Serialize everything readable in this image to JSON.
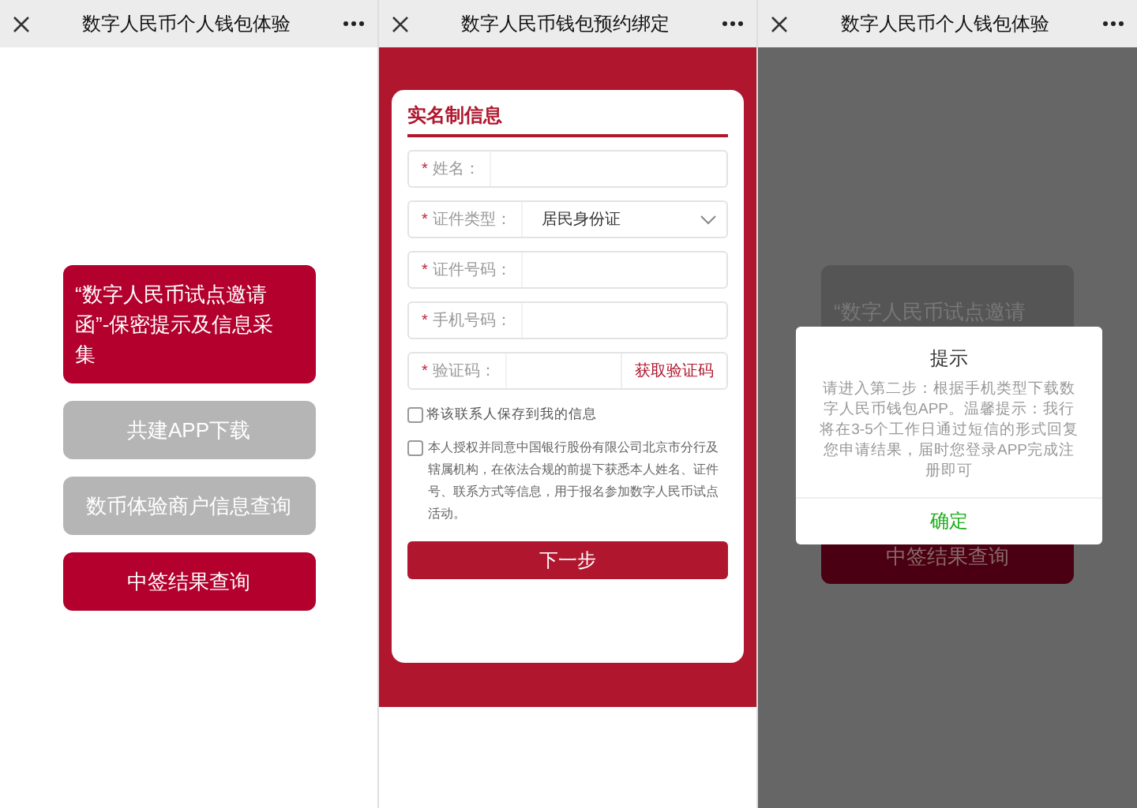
{
  "panels": [
    {
      "kind": "menu",
      "title": "数字人民币个人钱包体验",
      "buttons": [
        {
          "label": "“数字人民币试点邀请函”-保密提示及信息采集",
          "disabled": false
        },
        {
          "label": "共建APP下载",
          "disabled": true
        },
        {
          "label": "数币体验商户信息查询",
          "disabled": true
        },
        {
          "label": "中签结果查询",
          "disabled": false
        }
      ]
    },
    {
      "kind": "form",
      "title": "数字人民币钱包预约绑定",
      "section_title": "实名制信息",
      "fields": [
        {
          "kind": "text",
          "mark": "*",
          "label": "姓名："
        },
        {
          "kind": "select",
          "mark": "*",
          "label": "证件类型：",
          "value": "居民身份证"
        },
        {
          "kind": "text",
          "mark": "*",
          "label": "证件号码："
        },
        {
          "kind": "text",
          "mark": "*",
          "label": "手机号码："
        },
        {
          "kind": "code",
          "mark": "*",
          "label": "验证码：",
          "action": "获取验证码"
        }
      ],
      "save_contact": {
        "label": "将该联系人保存到我的信息",
        "checked": false
      },
      "consent": {
        "text": "本人授权并同意中国银行股份有限公司北京市分行及辖属机构，在依法合规的前提下获悉本人姓名、证件号、联系方式等信息，用于报名参加数字人民币试点活动。",
        "checked": false
      },
      "submit": "下一步"
    },
    {
      "kind": "dialog",
      "title": "数字人民币个人钱包体验",
      "background_buttons": [
        {
          "label": "“数字人民币试点邀请",
          "disabled": false
        },
        {
          "label": "中签结果查询",
          "disabled": false
        }
      ],
      "dialog": {
        "title": "提示",
        "message": "请进入第二步：根据手机类型下载数字人民币钱包APP。温馨提示：我行将在3-5个工作日通过短信的形式回复您申请结果，届时您登录APP完成注册即可",
        "button": "确定"
      }
    }
  ]
}
